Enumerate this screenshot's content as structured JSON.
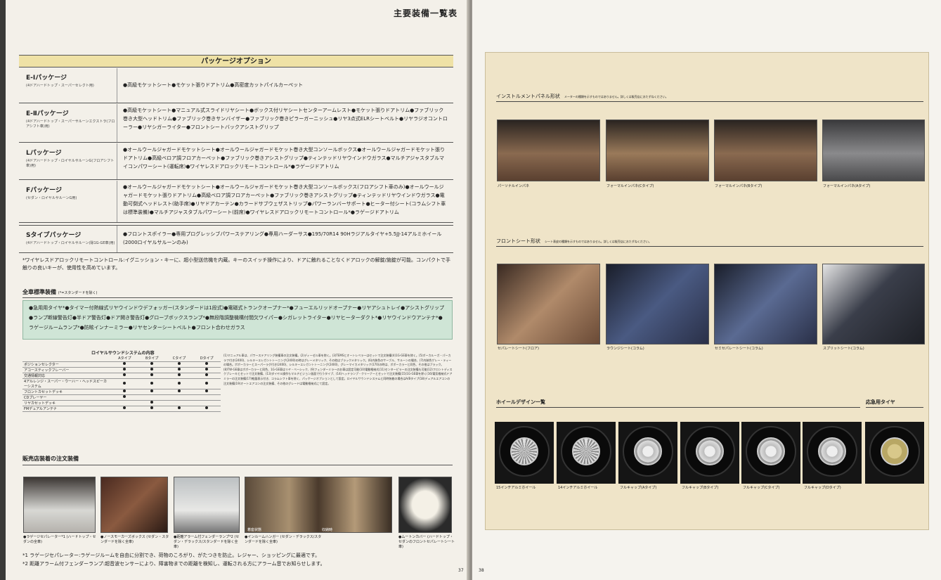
{
  "left": {
    "header": "主要装備一覧表",
    "package_title": "パッケージオプション",
    "packages": [
      {
        "name": "E-Ⅰパッケージ",
        "sub": "(4ドアハードトップ・スーパーセレクト用)",
        "desc": "●高級モケットシート●モケット張りドアトリム●高密度カットパイルカーペット"
      },
      {
        "name": "E-Ⅱパッケージ",
        "sub": "(4ドアハードトップ・スーパーサルーンエクストラ(フロアシフト車)用)",
        "desc": "●高級モケットシート●マニュアル式スライドリヤシート●ボックス付リヤシートセンターアームレスト●モケット張りドアトリム●ファブリック巻き大型ヘッドトリム●ファブリック巻きサンバイザー●ファブリック巻きピラーガーニッシュ●リヤ3点式ELRシートベルト●リヤラジオコントローラー●リヤシガーライター●フロントシートバックアシストグリップ"
      },
      {
        "name": "Lパッケージ",
        "sub": "(4ドアハードトップ・ロイヤルサルーンG(フロアシフト車)用)",
        "desc": "●オールウールジャガードモケットシート●オールウールジャガードモケット巻き大型コンソールボックス●オールウールジャガードモケット張りドアトリム●高級ベロア調フロアカーペット●ファブリック巻きアシストグリップ●ティンテッドリヤウインドウガラス●マルチアジャスタブルマイコンパワーシート(運転席)●ワイヤレスドアロックリモートコントロール*●ラゲージドアトリム"
      },
      {
        "name": "Fパッケージ",
        "sub": "(セダン・ロイヤルサルーンG用)",
        "desc": "●オールウールジャガードモケットシート●オールウールジャガードモケット巻き大型コンソールボックス(フロアシフト車のみ)●オールウールジャガードモケット張りドアトリム●高級ベロア調フロアカーペット●ファブリック巻きアシストグリップ●ティンテッドリヤウインドウガラス●電動可倒式ヘッドレスト(助手席)●リヤドアカーテン●カラードサブウェザストリップ●パワーランバーサポート●ヒーター付シート(コラムシフト車は標準装備)●マルチアジャスタブルパワーシート(前席)●ワイヤレスドアロックリモートコントロール*●ラゲージドアトリム"
      },
      {
        "name": "Sタイプパッケージ",
        "sub": "(4ドアハードトップ・ロイヤルサルーン(除1G-GE車)用)",
        "desc": "●フロントスポイラー●専用プログレッシブパワーステアリング●専用ハーダーサス●195/70R14 90Hラジアルタイヤ+5.5JJ-14アルミホイール(2000ロイヤルサルーンのみ)"
      }
    ],
    "wireless_note": "*ワイヤレスドアロックリモートコントロール:イグニッション・キーに、超小型送信機を内蔵。キーのスイッチ操作により、ドアに触れることなくドアロックの解錠/施錠が可能。コンパクトで手触りの良いキーが、使用性を高めています。",
    "std_title": "全車標準装備",
    "std_sub": "(*=スタンダードを除く)",
    "std_text": "●急用用タイヤ*●タイマー付熱線式リヤウインドウデフォッガー(スタンダードは1段式)●電磁式トランクオープナー*●フューエルリッドオープナー●リヤアシュトレイ●アシストグリップ●ランプ断線警告灯●半ドア警告灯●ドア開き警告灯●グローブボックスランプ*●無段階調整機構付間欠ワイパー●シガレットライター●リヤヒーターダクト*●リヤウインドウアンテナ*●ラゲージルームランプ*●防眩インナーミラー●リヤセンターシートベルト●フロント合わせガラス",
    "sound_title": "ロイヤルサウンドシステムの内容",
    "sound_headers": [
      "",
      "Aタイプ",
      "Bタイプ",
      "Cタイプ",
      "Dタイプ"
    ],
    "sound_rows": [
      {
        "label": "ポジションセレクター",
        "v": [
          1,
          1,
          1,
          1
        ]
      },
      {
        "label": "アコースティックフレーバー",
        "v": [
          1,
          1,
          1,
          1
        ]
      },
      {
        "label": "交通情報対応",
        "v": [
          1,
          1,
          1,
          1
        ]
      },
      {
        "label": "4アルレンジ・スーパー・ウーハー・ヘッドスピーカーシステム",
        "v": [
          1,
          1,
          1,
          1
        ]
      },
      {
        "label": "フロントカセットデッキ",
        "v": [
          1,
          1,
          1,
          1
        ]
      },
      {
        "label": "CDプレーヤー",
        "v": [
          1,
          0,
          0,
          0
        ]
      },
      {
        "label": "リヤカセットデッキ",
        "v": [
          0,
          1,
          0,
          0
        ]
      },
      {
        "label": "FMデュアルアンテナ",
        "v": [
          1,
          1,
          1,
          1
        ]
      }
    ],
    "small_notes": "(1)マニュアル車は、パワーステアリング装備車の注文装備。(2)ディーゼル車を除く。(3)TEMSとオートレベラーはセットで注文装備(4)1G-GE車を除く。(5)ボーカルーガ・パーカラフ付き(2400)、シルキーエレガントトーニング(2400)の時はグレーメタリック、その他はブラックメタリック。(6)内装色のサーブル、サルーンの場合、(7)内装色ゲレー・ティーの場合。ポボーカラーとスーパーラグ付き(2400)、シルキーエレガントトーニング(2400)、グレーマイカメタリック(170)の時は、ボボーカラーと同色、その他はブラック。(8)TW-GE車はボボーカラーと同色、1G-GE車はリヤ・ベーシック、(9)フェンダーミラーのお車は設定可能(10)電動格納式(11)センターピラーの注文装備も可能(12)フロントディスクブレーキとセットで注文装備、(13)ダイヤル操作もマルチビジョン画面で行うタイプ、(14)ヘッドランプ・クリーナーとセットで注文装備(15)1G-GE車を除く(16)電気格納式ドアミラーの注文装備(17)軽量表示付き、コラムシフト車を除く、パッケージオプションとして設定。ロイヤルサウンドシステムと同時装着の場合はA/Bタイプ(18)デュアルエアコンの注文装備(19)オートエアコンの注文装備、その他のグレードは電動格納式にて設定。",
    "dealer_title": "販売店装着の注文装備",
    "dealer_caps": [
      "●ラゲージセパレーター*1 (ハードトップ・セダンの全車)",
      "●ノースモーカーズボックス (セダン・スタンダードを除く全車)",
      "●距離アラーム付フェンダーランプ*2 (セダン・デラックス/スタンダードを除く全車)",
      "●インルームハンガー (セダン・デラックス/スタンダードを除く全車)",
      "●ムートンカバー (ハードトップ・セダンのフロントセパレートシート車)"
    ],
    "photo_labels": [
      "着座状態",
      "収納時"
    ],
    "foot1": "*1 ラゲージセパレーター:ラゲージルームを自由に分割でき、荷物のころがり、がたつきを防止。レジャー、ショッピングに最適です。",
    "foot2": "*2 距離アラーム付フェンダーランプ:超音波センサーにより、障害物までの距離を検知し、運転される方にアラーム音でお知らせします。",
    "page_no": "37"
  },
  "right": {
    "panel_title": "インストルメントパネル形状",
    "panel_note": "メーターの種類を示すものではありません。詳しくは販売店におたずねください。",
    "panel_caps": [
      "パーソナルインパネ",
      "フォーマルインパネ(Cタイプ)",
      "フォーマルインパネ(Bタイプ)",
      "フォーマルインパネ(Aタイプ)"
    ],
    "seat_title": "フロントシート形状",
    "seat_note": "シート表皮の種類を示すものではありません。詳しくは販売店におたずねください。",
    "seat_caps": [
      "セパレートシート(フロア)",
      "ラウンジシート(コラム)",
      "セミセパレートシート(コラム)",
      "スプリットシート(コラム)"
    ],
    "wheel_title": "ホイールデザイン一覧",
    "spare_title": "応急用タイヤ",
    "wheel_caps": [
      "15インチアルミホイール",
      "14インチアルミホイール",
      "フルキャップ(Aタイプ)",
      "フルキャップ(Bタイプ)",
      "フルキャップ(Cタイプ)",
      "フルキャップ(Dタイプ)"
    ],
    "page_no": "38"
  }
}
